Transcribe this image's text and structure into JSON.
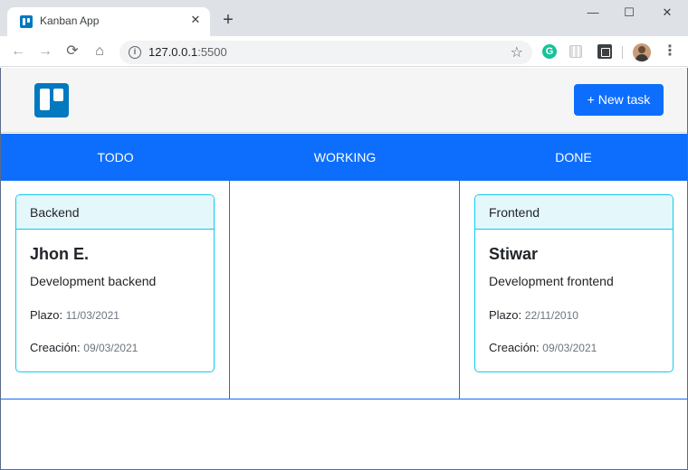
{
  "browser": {
    "tab_title": "Kanban App",
    "tab_close": "✕",
    "new_tab": "+",
    "url_host": "127.0.0.1",
    "url_port": ":5500",
    "window_controls": {
      "minimize": "—",
      "maximize": "☐",
      "close": "✕"
    },
    "nav": {
      "back": "←",
      "forward": "→",
      "reload": "⟳",
      "home": "⌂"
    },
    "info_icon": "i",
    "bookmark": "☆",
    "grammarly": "G",
    "menu": "⋮"
  },
  "navbar": {
    "logo_icon": "trello-logo-icon",
    "new_task_label": "+ New task"
  },
  "columns": [
    {
      "label": "TODO"
    },
    {
      "label": "WORKING"
    },
    {
      "label": "DONE"
    }
  ],
  "cards": {
    "todo": [
      {
        "header": "Backend",
        "title": "Jhon E.",
        "description": "Development backend",
        "plazo_label": "Plazo:",
        "plazo": "11/03/2021",
        "creacion_label": "Creación:",
        "creacion": "09/03/2021"
      }
    ],
    "working": [],
    "done": [
      {
        "header": "Frontend",
        "title": "Stiwar",
        "description": "Development frontend",
        "plazo_label": "Plazo:",
        "plazo": "22/11/2010",
        "creacion_label": "Creación:",
        "creacion": "09/03/2021"
      }
    ]
  },
  "colors": {
    "primary": "#0d6efd",
    "card_border": "#0dcaf0",
    "card_header_bg": "#e4f7fb",
    "navbar_bg": "#f5f5f5",
    "logo": "#0079bf"
  }
}
